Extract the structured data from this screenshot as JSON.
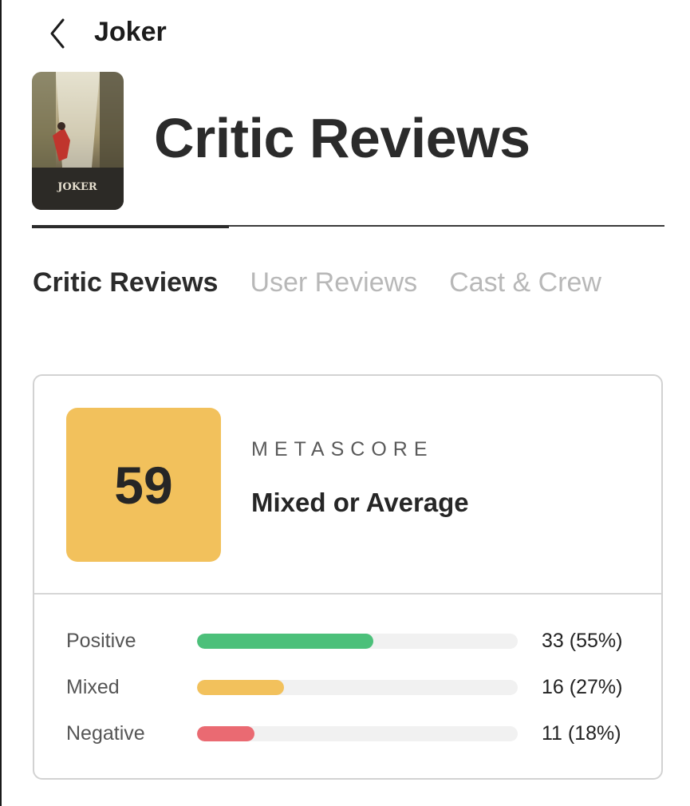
{
  "nav": {
    "title": "Joker"
  },
  "header": {
    "page_title": "Critic Reviews",
    "poster_text": "JOKER"
  },
  "tabs": [
    {
      "label": "Critic Reviews",
      "active": true
    },
    {
      "label": "User Reviews",
      "active": false
    },
    {
      "label": "Cast & Crew",
      "active": false
    }
  ],
  "metascore": {
    "label": "METASCORE",
    "value": "59",
    "verdict": "Mixed or Average",
    "color": "#f2c15c"
  },
  "distribution": [
    {
      "label": "Positive",
      "count": "33 (55%)",
      "fraction": 0.55,
      "color": "#4cc07a"
    },
    {
      "label": "Mixed",
      "count": "16 (27%)",
      "fraction": 0.27,
      "color": "#f2c15c"
    },
    {
      "label": "Negative",
      "count": "11 (18%)",
      "fraction": 0.18,
      "color": "#ea6a72"
    }
  ],
  "colors": {
    "track": "#f1f1f1",
    "inactive_tab": "#b8b8b8"
  },
  "icons": {
    "back": "chevron-left-icon"
  }
}
